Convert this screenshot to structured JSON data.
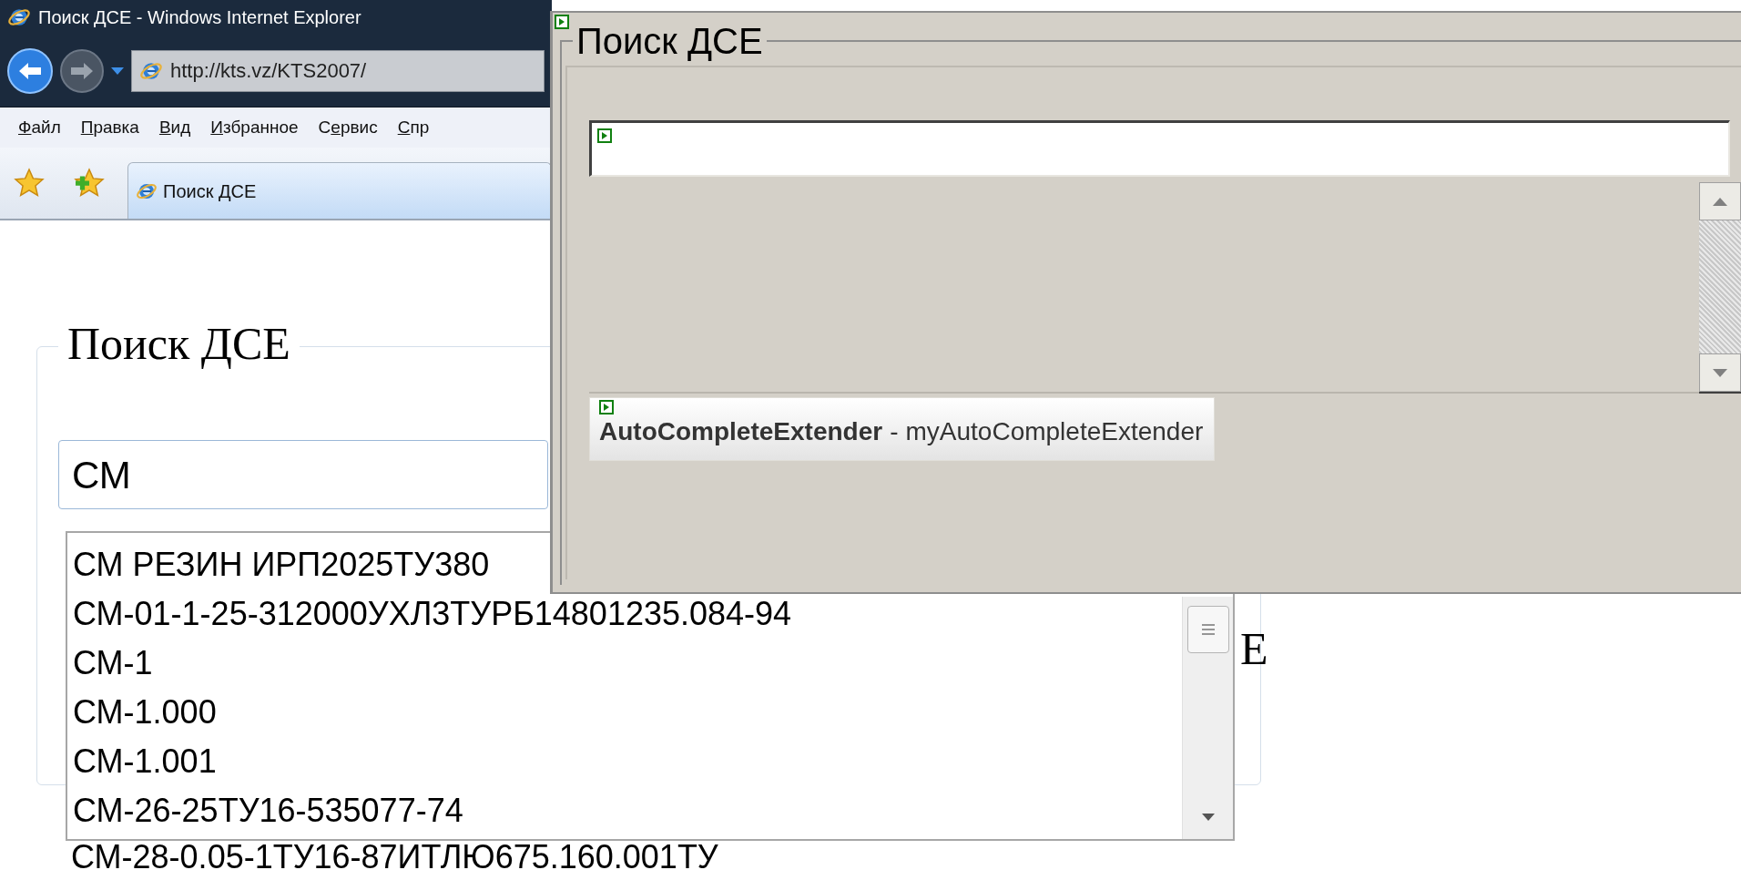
{
  "browser": {
    "title": "Поиск ДСЕ - Windows Internet Explorer",
    "address": "http://kts.vz/KTS2007/",
    "menu": [
      {
        "key": "Ф",
        "rest": "айл"
      },
      {
        "key": "П",
        "rest": "равка"
      },
      {
        "key": "В",
        "rest": "ид"
      },
      {
        "key": "И",
        "rest": "збранное"
      },
      {
        "lead": "С",
        "key": "е",
        "rest": "рвис"
      },
      {
        "key": "С",
        "rest": "пр"
      }
    ],
    "tab": {
      "label": "Поиск ДСЕ",
      "selected": true
    }
  },
  "page": {
    "legend": "Поиск ДСЕ",
    "search": {
      "value": "СМ"
    },
    "suggestions": [
      "СМ РЕЗИН ИРП2025ТУ380",
      "СМ-01-1-25-312000УХЛ3ТУРБ14801235.084-94",
      "СМ-1",
      "СМ-1.000",
      "СМ-1.001",
      "СМ-26-25ТУ16-535077-74"
    ],
    "overflow_item": "СМ-28-0.05-1ТУ16-87ИТЛЮ675.160.001ТУ",
    "cut_text": "E"
  },
  "designer": {
    "legend": "Поиск ДСЕ",
    "component": {
      "type_name": "AutoCompleteExtender",
      "separator": "-",
      "instance": "myAutoCompleteExtender"
    }
  }
}
